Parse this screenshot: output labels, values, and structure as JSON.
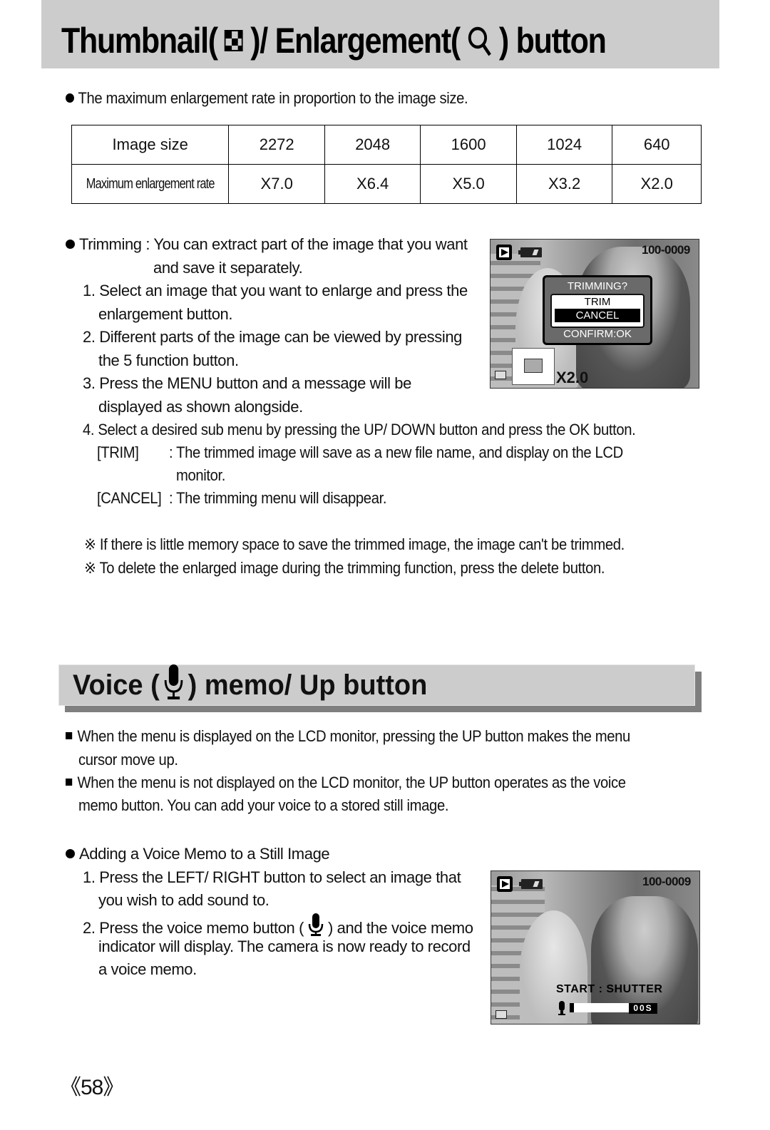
{
  "header": {
    "title_part1": "Thumbnail(",
    "title_part2": ")/ Enlargement(",
    "title_part3": ") button",
    "icons": [
      "thumbnail-icon",
      "magnifier-icon"
    ]
  },
  "enlargement": {
    "intro": "The maximum enlargement rate in proportion to the image size.",
    "table": {
      "row_headers": [
        "Image size",
        "Maximum enlargement rate"
      ],
      "image_sizes": [
        "2272",
        "2048",
        "1600",
        "1024",
        "640"
      ],
      "rates": [
        "X7.0",
        "X6.4",
        "X5.0",
        "X3.2",
        "X2.0"
      ]
    }
  },
  "trimming": {
    "intro_line1": "Trimming : You can extract part of the image that you want",
    "intro_line2": "and save it separately.",
    "steps": [
      [
        "1. Select an image that you want to enlarge and press the",
        "enlargement button."
      ],
      [
        "2. Different parts of the image can be viewed by pressing",
        "the 5 function button."
      ],
      [
        "3. Press the MENU button and a message will be",
        "displayed as shown alongside."
      ],
      [
        "4. Select a desired sub menu by pressing the UP/ DOWN button and press the OK button."
      ]
    ],
    "trim_label": "[TRIM]",
    "trim_desc_line1": ": The trimmed image will save as a new file name, and display on the LCD",
    "trim_desc_line2": "monitor.",
    "cancel_label": "[CANCEL]",
    "cancel_desc": ": The trimming menu will disappear.",
    "notes": [
      "※  If there is little memory space to save the trimmed image, the image can't be trimmed.",
      "※  To delete the enlarged image during the trimming function, press the delete button."
    ],
    "lcd": {
      "file_number": "100-0009",
      "dialog_title": "TRIMMING?",
      "options": [
        "TRIM",
        "CANCEL"
      ],
      "selected_option": "CANCEL",
      "confirm_hint": "CONFIRM:OK",
      "zoom_rate": "X2.0"
    }
  },
  "voice": {
    "title_part1": "Voice (",
    "title_part2": ") memo/ Up button",
    "bullets": [
      [
        "When the menu is displayed on the LCD monitor, pressing the UP button makes the menu",
        "cursor move up."
      ],
      [
        "When the menu is not displayed on the LCD monitor, the UP button operates as the voice",
        "memo button. You can add your voice to a stored still image."
      ]
    ],
    "adding_heading": "Adding a Voice Memo to a Still Image",
    "steps": {
      "s1_line1": "1. Press the LEFT/ RIGHT button to select an image that",
      "s1_line2": "you wish to add sound to.",
      "s2_line1_a": "2. Press the voice memo button (",
      "s2_line1_b": ") and the voice memo",
      "s2_line2": "indicator will display. The camera is now ready to record",
      "s2_line3": "a voice memo."
    },
    "lcd": {
      "file_number": "100-0009",
      "start_hint": "START : SHUTTER",
      "record_time": "00S",
      "record_progress": 0.05
    }
  },
  "footer": {
    "page_number": "《58》"
  }
}
